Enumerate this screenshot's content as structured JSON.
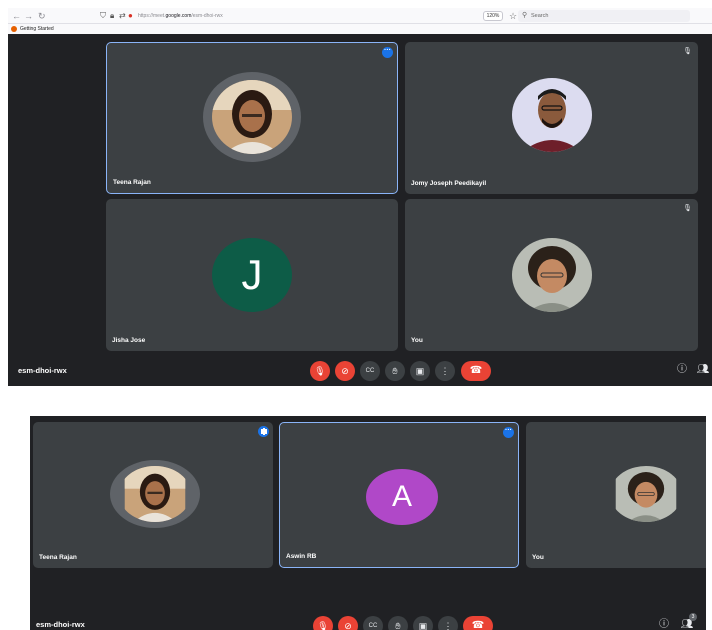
{
  "browser": {
    "url_prefix": "https://meet.",
    "url_domain": "google.com",
    "url_path": "/esm-dhoi-rwx",
    "zoom": "120%",
    "search_placeholder": "Search",
    "bookmark": "Getting Started"
  },
  "meeting_code": "esm-dhoi-rwx",
  "shot1": {
    "participants": [
      {
        "name": "Teena Rajan",
        "type": "photo",
        "active": true
      },
      {
        "name": "Jomy Joseph Peedikayil",
        "type": "photo",
        "muted": true
      },
      {
        "name": "Jisha Jose",
        "type": "initial",
        "initial": "J",
        "color": "#0d5c47"
      },
      {
        "name": "You",
        "type": "photo",
        "muted": true
      }
    ]
  },
  "shot2": {
    "participants": [
      {
        "name": "Teena Rajan",
        "type": "photo",
        "speaking": true
      },
      {
        "name": "Aswin RB",
        "type": "initial",
        "initial": "A",
        "color": "#b048c8",
        "active": true
      },
      {
        "name": "You",
        "type": "photo"
      }
    ],
    "participant_count": "3"
  },
  "controls": [
    {
      "name": "mic-off",
      "icon": "mic-off-icon"
    },
    {
      "name": "camera-off",
      "icon": "camera-off-icon"
    },
    {
      "name": "captions",
      "icon": "captions-icon",
      "label": "CC"
    },
    {
      "name": "raise-hand",
      "icon": "hand-icon"
    },
    {
      "name": "present",
      "icon": "present-icon"
    },
    {
      "name": "more",
      "icon": "more-vert-icon"
    },
    {
      "name": "leave-call",
      "icon": "phone-hangup-icon"
    }
  ],
  "colors": {
    "meet_bg": "#202124",
    "tile_bg": "#3c4043",
    "active_border": "#8ab4f8",
    "danger": "#ea4335",
    "accent": "#1a73e8"
  }
}
